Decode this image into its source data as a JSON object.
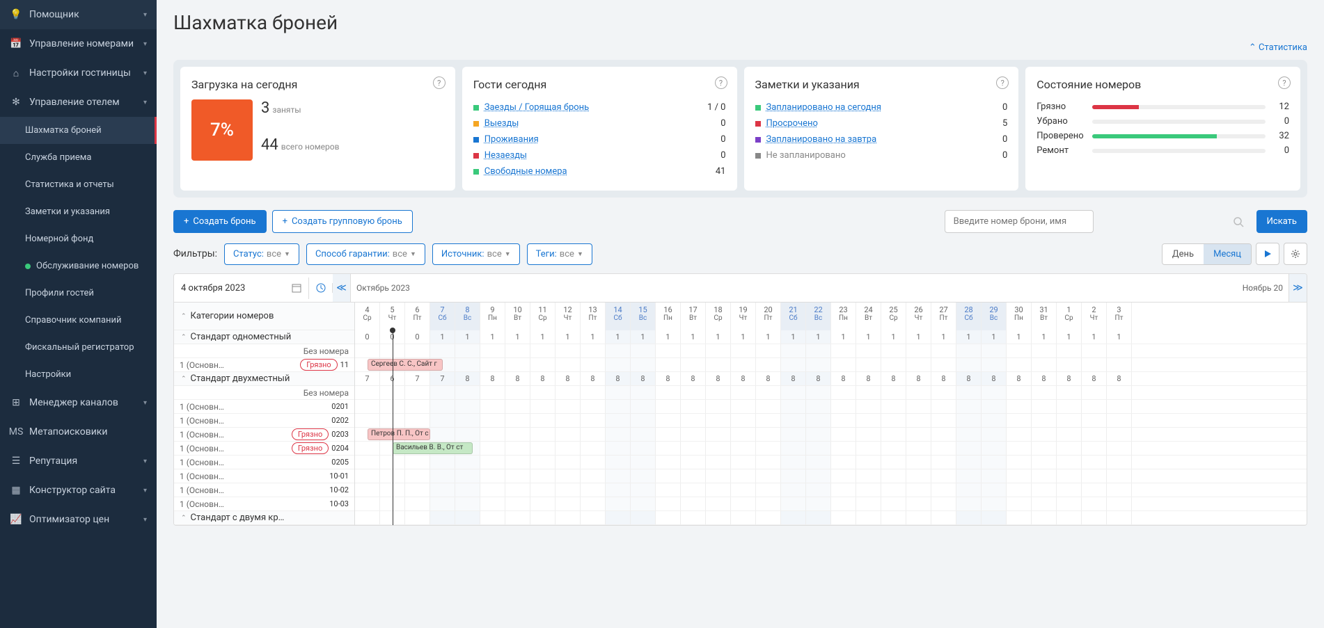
{
  "sidebar": {
    "items": [
      {
        "icon": "bulb",
        "label": "Помощник",
        "chev": true
      },
      {
        "icon": "calendar",
        "label": "Управление номерами",
        "chev": true
      },
      {
        "icon": "home",
        "label": "Настройки гостиницы",
        "chev": true
      },
      {
        "icon": "gear",
        "label": "Управление отелем",
        "chev": true,
        "expanded": true
      },
      {
        "sub": true,
        "label": "Шахматка броней",
        "active": true
      },
      {
        "sub": true,
        "label": "Служба приема"
      },
      {
        "sub": true,
        "label": "Статистика и отчеты"
      },
      {
        "sub": true,
        "label": "Заметки и указания"
      },
      {
        "sub": true,
        "label": "Номерной фонд"
      },
      {
        "sub": true,
        "label": "Обслуживание номеров",
        "dot": "#3ac97b"
      },
      {
        "sub": true,
        "label": "Профили гостей"
      },
      {
        "sub": true,
        "label": "Справочник компаний"
      },
      {
        "sub": true,
        "label": "Фискальный регистратор"
      },
      {
        "sub": true,
        "label": "Настройки"
      },
      {
        "icon": "channels",
        "label": "Менеджер каналов",
        "chev": true
      },
      {
        "icon": "meta",
        "label": "Метапоисковики",
        "badge": "MS"
      },
      {
        "icon": "rep",
        "label": "Репутация",
        "chev": true
      },
      {
        "icon": "site",
        "label": "Конструктор сайта",
        "chev": true
      },
      {
        "icon": "chart",
        "label": "Оптимизатор цен",
        "chev": true
      }
    ]
  },
  "page_title": "Шахматка броней",
  "stats_toggle": "Статистика",
  "cards": {
    "load": {
      "title": "Загрузка на сегодня",
      "percent": "7%",
      "busy_n": "3",
      "busy_label": "заняты",
      "total_n": "44",
      "total_label": "всего номеров"
    },
    "guests": {
      "title": "Гости сегодня",
      "rows": [
        {
          "color": "#3ac97b",
          "label": "Заезды / Горящая бронь",
          "val": "1 / 0"
        },
        {
          "color": "#f5a623",
          "label": "Выезды",
          "val": "0"
        },
        {
          "color": "#1976d2",
          "label": "Проживания",
          "val": "0"
        },
        {
          "color": "#dc3545",
          "label": "Незаезды",
          "val": "0"
        },
        {
          "color": "#3ac97b",
          "label": "Свободные номера",
          "val": "41"
        }
      ]
    },
    "notes": {
      "title": "Заметки и указания",
      "rows": [
        {
          "color": "#3ac97b",
          "label": "Запланировано на сегодня",
          "val": "0"
        },
        {
          "color": "#dc3545",
          "label": "Просрочено",
          "val": "5"
        },
        {
          "color": "#7b3fc7",
          "label": "Запланировано на завтра",
          "val": "0"
        },
        {
          "color": "#888",
          "label": "Не запланировано",
          "val": "0",
          "plain": true
        }
      ]
    },
    "rooms": {
      "title": "Состояние номеров",
      "rows": [
        {
          "label": "Грязно",
          "val": "12",
          "color": "#dc3545",
          "pct": 27
        },
        {
          "label": "Убрано",
          "val": "0",
          "color": "#1976d2",
          "pct": 0
        },
        {
          "label": "Проверено",
          "val": "32",
          "color": "#3ac97b",
          "pct": 72
        },
        {
          "label": "Ремонт",
          "val": "0",
          "color": "#333",
          "pct": 0
        }
      ]
    }
  },
  "actions": {
    "create": "Создать бронь",
    "create_group": "Создать групповую бронь",
    "search_placeholder": "Введите номер брони, имя гостя или Email",
    "search_btn": "Искать"
  },
  "filters": {
    "label": "Фильтры:",
    "status": "Статус:",
    "guarantee": "Способ гарантии:",
    "source": "Источник:",
    "tags": "Теги:",
    "all": "все",
    "day": "День",
    "month": "Месяц"
  },
  "calendar": {
    "date": "4 октября 2023",
    "month": "Октябрь 2023",
    "next_month": "Ноябрь 20",
    "cat_header": "Категории номеров",
    "days": [
      {
        "n": "4",
        "d": "Ср"
      },
      {
        "n": "5",
        "d": "Чт",
        "today": true
      },
      {
        "n": "6",
        "d": "Пт"
      },
      {
        "n": "7",
        "d": "Сб",
        "w": true
      },
      {
        "n": "8",
        "d": "Вс",
        "w": true
      },
      {
        "n": "9",
        "d": "Пн"
      },
      {
        "n": "10",
        "d": "Вт"
      },
      {
        "n": "11",
        "d": "Ср"
      },
      {
        "n": "12",
        "d": "Чт"
      },
      {
        "n": "13",
        "d": "Пт"
      },
      {
        "n": "14",
        "d": "Сб",
        "w": true
      },
      {
        "n": "15",
        "d": "Вс",
        "w": true
      },
      {
        "n": "16",
        "d": "Пн"
      },
      {
        "n": "17",
        "d": "Вт"
      },
      {
        "n": "18",
        "d": "Ср"
      },
      {
        "n": "19",
        "d": "Чт"
      },
      {
        "n": "20",
        "d": "Пт"
      },
      {
        "n": "21",
        "d": "Сб",
        "w": true
      },
      {
        "n": "22",
        "d": "Вс",
        "w": true
      },
      {
        "n": "23",
        "d": "Пн"
      },
      {
        "n": "24",
        "d": "Вт"
      },
      {
        "n": "25",
        "d": "Ср"
      },
      {
        "n": "26",
        "d": "Чт"
      },
      {
        "n": "27",
        "d": "Пт"
      },
      {
        "n": "28",
        "d": "Сб",
        "w": true
      },
      {
        "n": "29",
        "d": "Вс",
        "w": true
      },
      {
        "n": "30",
        "d": "Пн"
      },
      {
        "n": "31",
        "d": "Вт"
      },
      {
        "n": "1",
        "d": "Ср"
      },
      {
        "n": "2",
        "d": "Чт"
      },
      {
        "n": "3",
        "d": "Пт"
      }
    ],
    "categories": [
      {
        "name": "Стандарт одноместный",
        "avail": [
          "0",
          "0",
          "0",
          "1",
          "1",
          "1",
          "1",
          "1",
          "1",
          "1",
          "1",
          "1",
          "1",
          "1",
          "1",
          "1",
          "1",
          "1",
          "1",
          "1",
          "1",
          "1",
          "1",
          "1",
          "1",
          "1",
          "1",
          "1",
          "1",
          "1",
          "1"
        ],
        "rooms": [
          {
            "name": "Без номера",
            "right": true
          },
          {
            "name": "1 (Основн…",
            "badge": "Грязно",
            "num": "11",
            "bookings": [
              {
                "text": "Сергеев С. С., Сайт г",
                "color": "red",
                "start": 0,
                "len": 3
              }
            ]
          }
        ]
      },
      {
        "name": "Стандарт двухместный",
        "avail": [
          "7",
          "6",
          "7",
          "7",
          "8",
          "8",
          "8",
          "8",
          "8",
          "8",
          "8",
          "8",
          "8",
          "8",
          "8",
          "8",
          "8",
          "8",
          "8",
          "8",
          "8",
          "8",
          "8",
          "8",
          "8",
          "8",
          "8",
          "8",
          "8",
          "8",
          "8"
        ],
        "rooms": [
          {
            "name": "Без номера",
            "right": true
          },
          {
            "name": "1 (Основн…",
            "num": "0201"
          },
          {
            "name": "1 (Основн…",
            "num": "0202"
          },
          {
            "name": "1 (Основн…",
            "badge": "Грязно",
            "num": "0203",
            "bookings": [
              {
                "text": "Петров П. П., От с",
                "color": "red",
                "start": 0,
                "len": 2.5
              }
            ]
          },
          {
            "name": "1 (Основн…",
            "badge": "Грязно",
            "num": "0204",
            "bookings": [
              {
                "text": "Васильев В. В., От ст",
                "color": "green",
                "start": 1,
                "len": 3.2
              }
            ]
          },
          {
            "name": "1 (Основн…",
            "num": "0205"
          },
          {
            "name": "1 (Основн…",
            "num": "10-01"
          },
          {
            "name": "1 (Основн…",
            "num": "10-02"
          },
          {
            "name": "1 (Основн…",
            "num": "10-03"
          }
        ]
      },
      {
        "name": "Стандарт с двумя кр…",
        "avail": [],
        "rooms": []
      }
    ]
  }
}
